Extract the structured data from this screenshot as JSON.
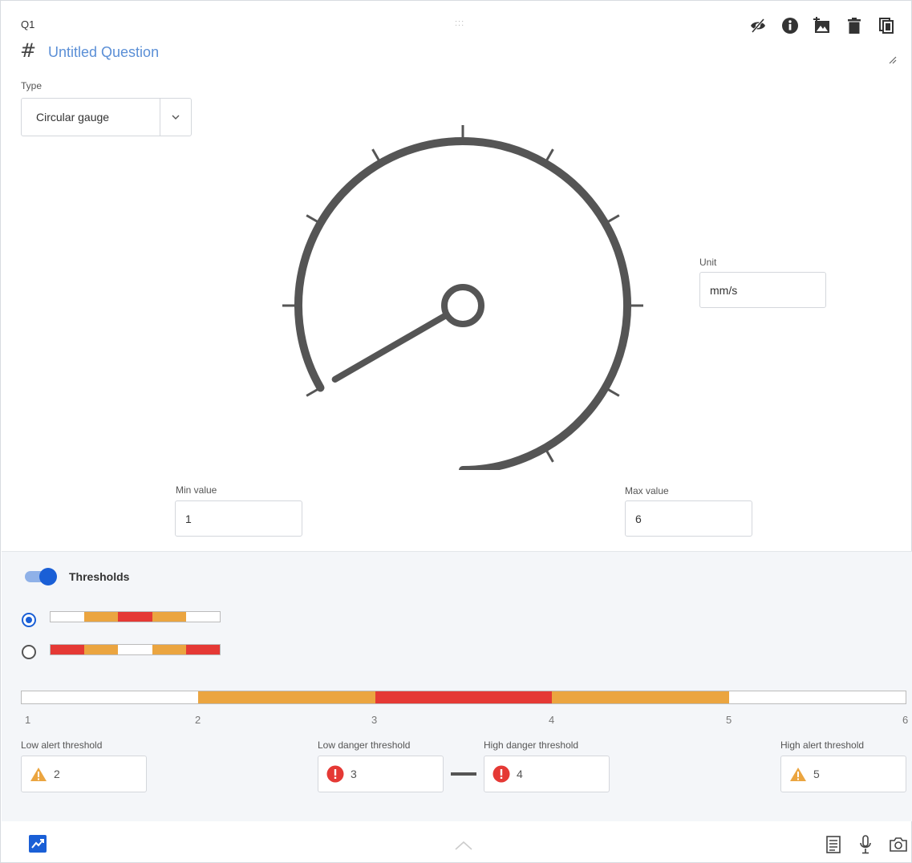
{
  "question": {
    "number": "Q1",
    "title": "Untitled Question",
    "drag_handle": ":::"
  },
  "toolbar": {
    "icons": [
      "eye-slash-icon",
      "info-icon",
      "add-image-icon",
      "trash-icon",
      "copy-icon"
    ]
  },
  "type_field": {
    "label": "Type",
    "value": "Circular gauge"
  },
  "unit_field": {
    "label": "Unit",
    "value": "mm/s"
  },
  "min_field": {
    "label": "Min value",
    "value": "1"
  },
  "max_field": {
    "label": "Max value",
    "value": "6"
  },
  "thresholds": {
    "toggle_label": "Thresholds",
    "enabled": true,
    "modes": [
      {
        "selected": true,
        "segments": [
          "#ffffff",
          "#eba540",
          "#e53935",
          "#eba540",
          "#ffffff"
        ]
      },
      {
        "selected": false,
        "segments": [
          "#e53935",
          "#eba540",
          "#ffffff",
          "#eba540",
          "#e53935"
        ]
      }
    ],
    "scale_ticks": [
      "1",
      "2",
      "3",
      "4",
      "5",
      "6"
    ],
    "scale_segments": [
      "#ffffff",
      "#eba540",
      "#e53935",
      "#eba540",
      "#ffffff"
    ],
    "low_alert": {
      "label": "Low alert threshold",
      "value": "2"
    },
    "low_danger": {
      "label": "Low danger threshold",
      "value": "3"
    },
    "high_danger": {
      "label": "High danger threshold",
      "value": "4"
    },
    "high_alert": {
      "label": "High alert threshold",
      "value": "5"
    }
  },
  "colors": {
    "accent": "#1a5fd6",
    "alert": "#eba540",
    "danger": "#e53935",
    "gauge": "#555555",
    "title": "#5b8fd6"
  },
  "footer": {
    "icons": [
      "chart-icon",
      "chevron-up-icon",
      "notes-icon",
      "microphone-icon",
      "camera-icon"
    ]
  }
}
